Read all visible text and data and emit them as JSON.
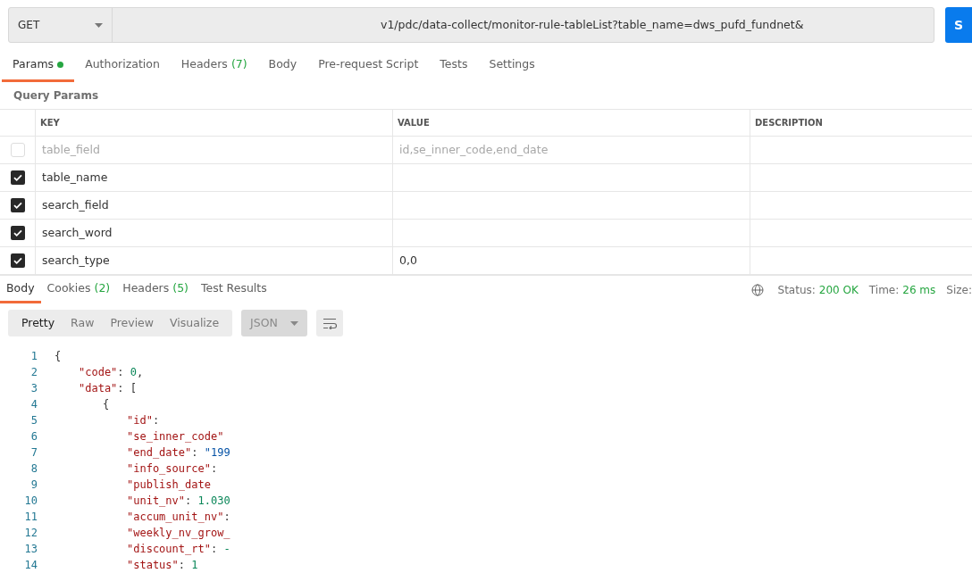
{
  "request": {
    "method": "GET",
    "url": "v1/pdc/data-collect/monitor-rule-tableList?table_name=dws_pufd_fundnet&",
    "send": "S"
  },
  "request_tabs": [
    {
      "label": "Params",
      "selected": true,
      "dot": true
    },
    {
      "label": "Authorization",
      "selected": false,
      "dot": false
    },
    {
      "label": "Headers",
      "count": "(7)",
      "selected": false,
      "dot": false
    },
    {
      "label": "Body",
      "selected": false,
      "dot": false
    },
    {
      "label": "Pre-request Script",
      "selected": false,
      "dot": false
    },
    {
      "label": "Tests",
      "selected": false,
      "dot": false
    },
    {
      "label": "Settings",
      "selected": false,
      "dot": false
    }
  ],
  "query_params": {
    "title": "Query Params",
    "columns": [
      "KEY",
      "VALUE",
      "DESCRIPTION"
    ],
    "rows": [
      {
        "key": "table_field",
        "value": "id,se_inner_code,end_date",
        "checked": false
      },
      {
        "key": "table_name",
        "checked": true
      },
      {
        "key": "search_field",
        "checked": true
      },
      {
        "key": "search_word",
        "checked": true
      },
      {
        "key": "search_type",
        "value": "0,0",
        "checked": true
      }
    ]
  },
  "response_tabs": [
    {
      "label": "Body",
      "selected": true
    },
    {
      "label": "Cookies",
      "count": "(2)",
      "selected": false
    },
    {
      "label": "Headers",
      "count": "(5)",
      "selected": false
    },
    {
      "label": "Test Results",
      "selected": false
    }
  ],
  "status": [
    {
      "label": "Status:",
      "value": "200 OK"
    },
    {
      "label": "Time:",
      "value": "26 ms"
    },
    {
      "label": "Size:"
    }
  ],
  "view_modes": [
    {
      "label": "Pretty",
      "selected": true
    },
    {
      "label": "Raw",
      "selected": false
    },
    {
      "label": "Preview",
      "selected": false
    },
    {
      "label": "Visualize",
      "selected": false
    }
  ],
  "format": "JSON",
  "code_lines": [
    {
      "number": "1",
      "tokens": [
        {
          "kind": "punct",
          "text": "{"
        }
      ]
    },
    {
      "number": "2",
      "tokens": [
        {
          "kind": "key",
          "text": "\"code\""
        },
        {
          "kind": "punct",
          "text": ": "
        },
        {
          "kind": "num",
          "text": "0"
        },
        {
          "kind": "punct",
          "text": ","
        }
      ]
    },
    {
      "number": "3",
      "tokens": [
        {
          "kind": "key",
          "text": "\"data\""
        },
        {
          "kind": "punct",
          "text": ": ["
        }
      ]
    },
    {
      "number": "4",
      "tokens": [
        {
          "kind": "punct",
          "text": "{"
        }
      ]
    },
    {
      "number": "5",
      "tokens": [
        {
          "kind": "key",
          "text": "\"id\""
        },
        {
          "kind": "punct",
          "text": ":"
        }
      ]
    },
    {
      "number": "6",
      "tokens": [
        {
          "kind": "key",
          "text": "\"se_inner_code\""
        }
      ]
    },
    {
      "number": "7",
      "tokens": [
        {
          "kind": "key",
          "text": "\"end_date\""
        },
        {
          "kind": "punct",
          "text": ": "
        },
        {
          "kind": "str",
          "text": "\"199"
        }
      ]
    },
    {
      "number": "8",
      "tokens": [
        {
          "kind": "key",
          "text": "\"info_source\""
        },
        {
          "kind": "punct",
          "text": ":"
        }
      ]
    },
    {
      "number": "9",
      "tokens": [
        {
          "kind": "key",
          "text": "\"publish_date"
        }
      ]
    },
    {
      "number": "10",
      "tokens": [
        {
          "kind": "key",
          "text": "\"unit_nv\""
        },
        {
          "kind": "punct",
          "text": ": "
        },
        {
          "kind": "num",
          "text": "1.030"
        }
      ]
    },
    {
      "number": "11",
      "tokens": [
        {
          "kind": "key",
          "text": "\"accum_unit_nv\""
        },
        {
          "kind": "punct",
          "text": ":"
        }
      ]
    },
    {
      "number": "12",
      "tokens": [
        {
          "kind": "key",
          "text": "\"weekly_nv_grow_"
        }
      ]
    },
    {
      "number": "13",
      "tokens": [
        {
          "kind": "key",
          "text": "\"discount_rt\""
        },
        {
          "kind": "punct",
          "text": ": "
        },
        {
          "kind": "num",
          "text": "-"
        }
      ]
    },
    {
      "number": "14",
      "tokens": [
        {
          "kind": "key",
          "text": "\"status\""
        },
        {
          "kind": "punct",
          "text": ": "
        },
        {
          "kind": "num",
          "text": "1"
        }
      ]
    }
  ]
}
